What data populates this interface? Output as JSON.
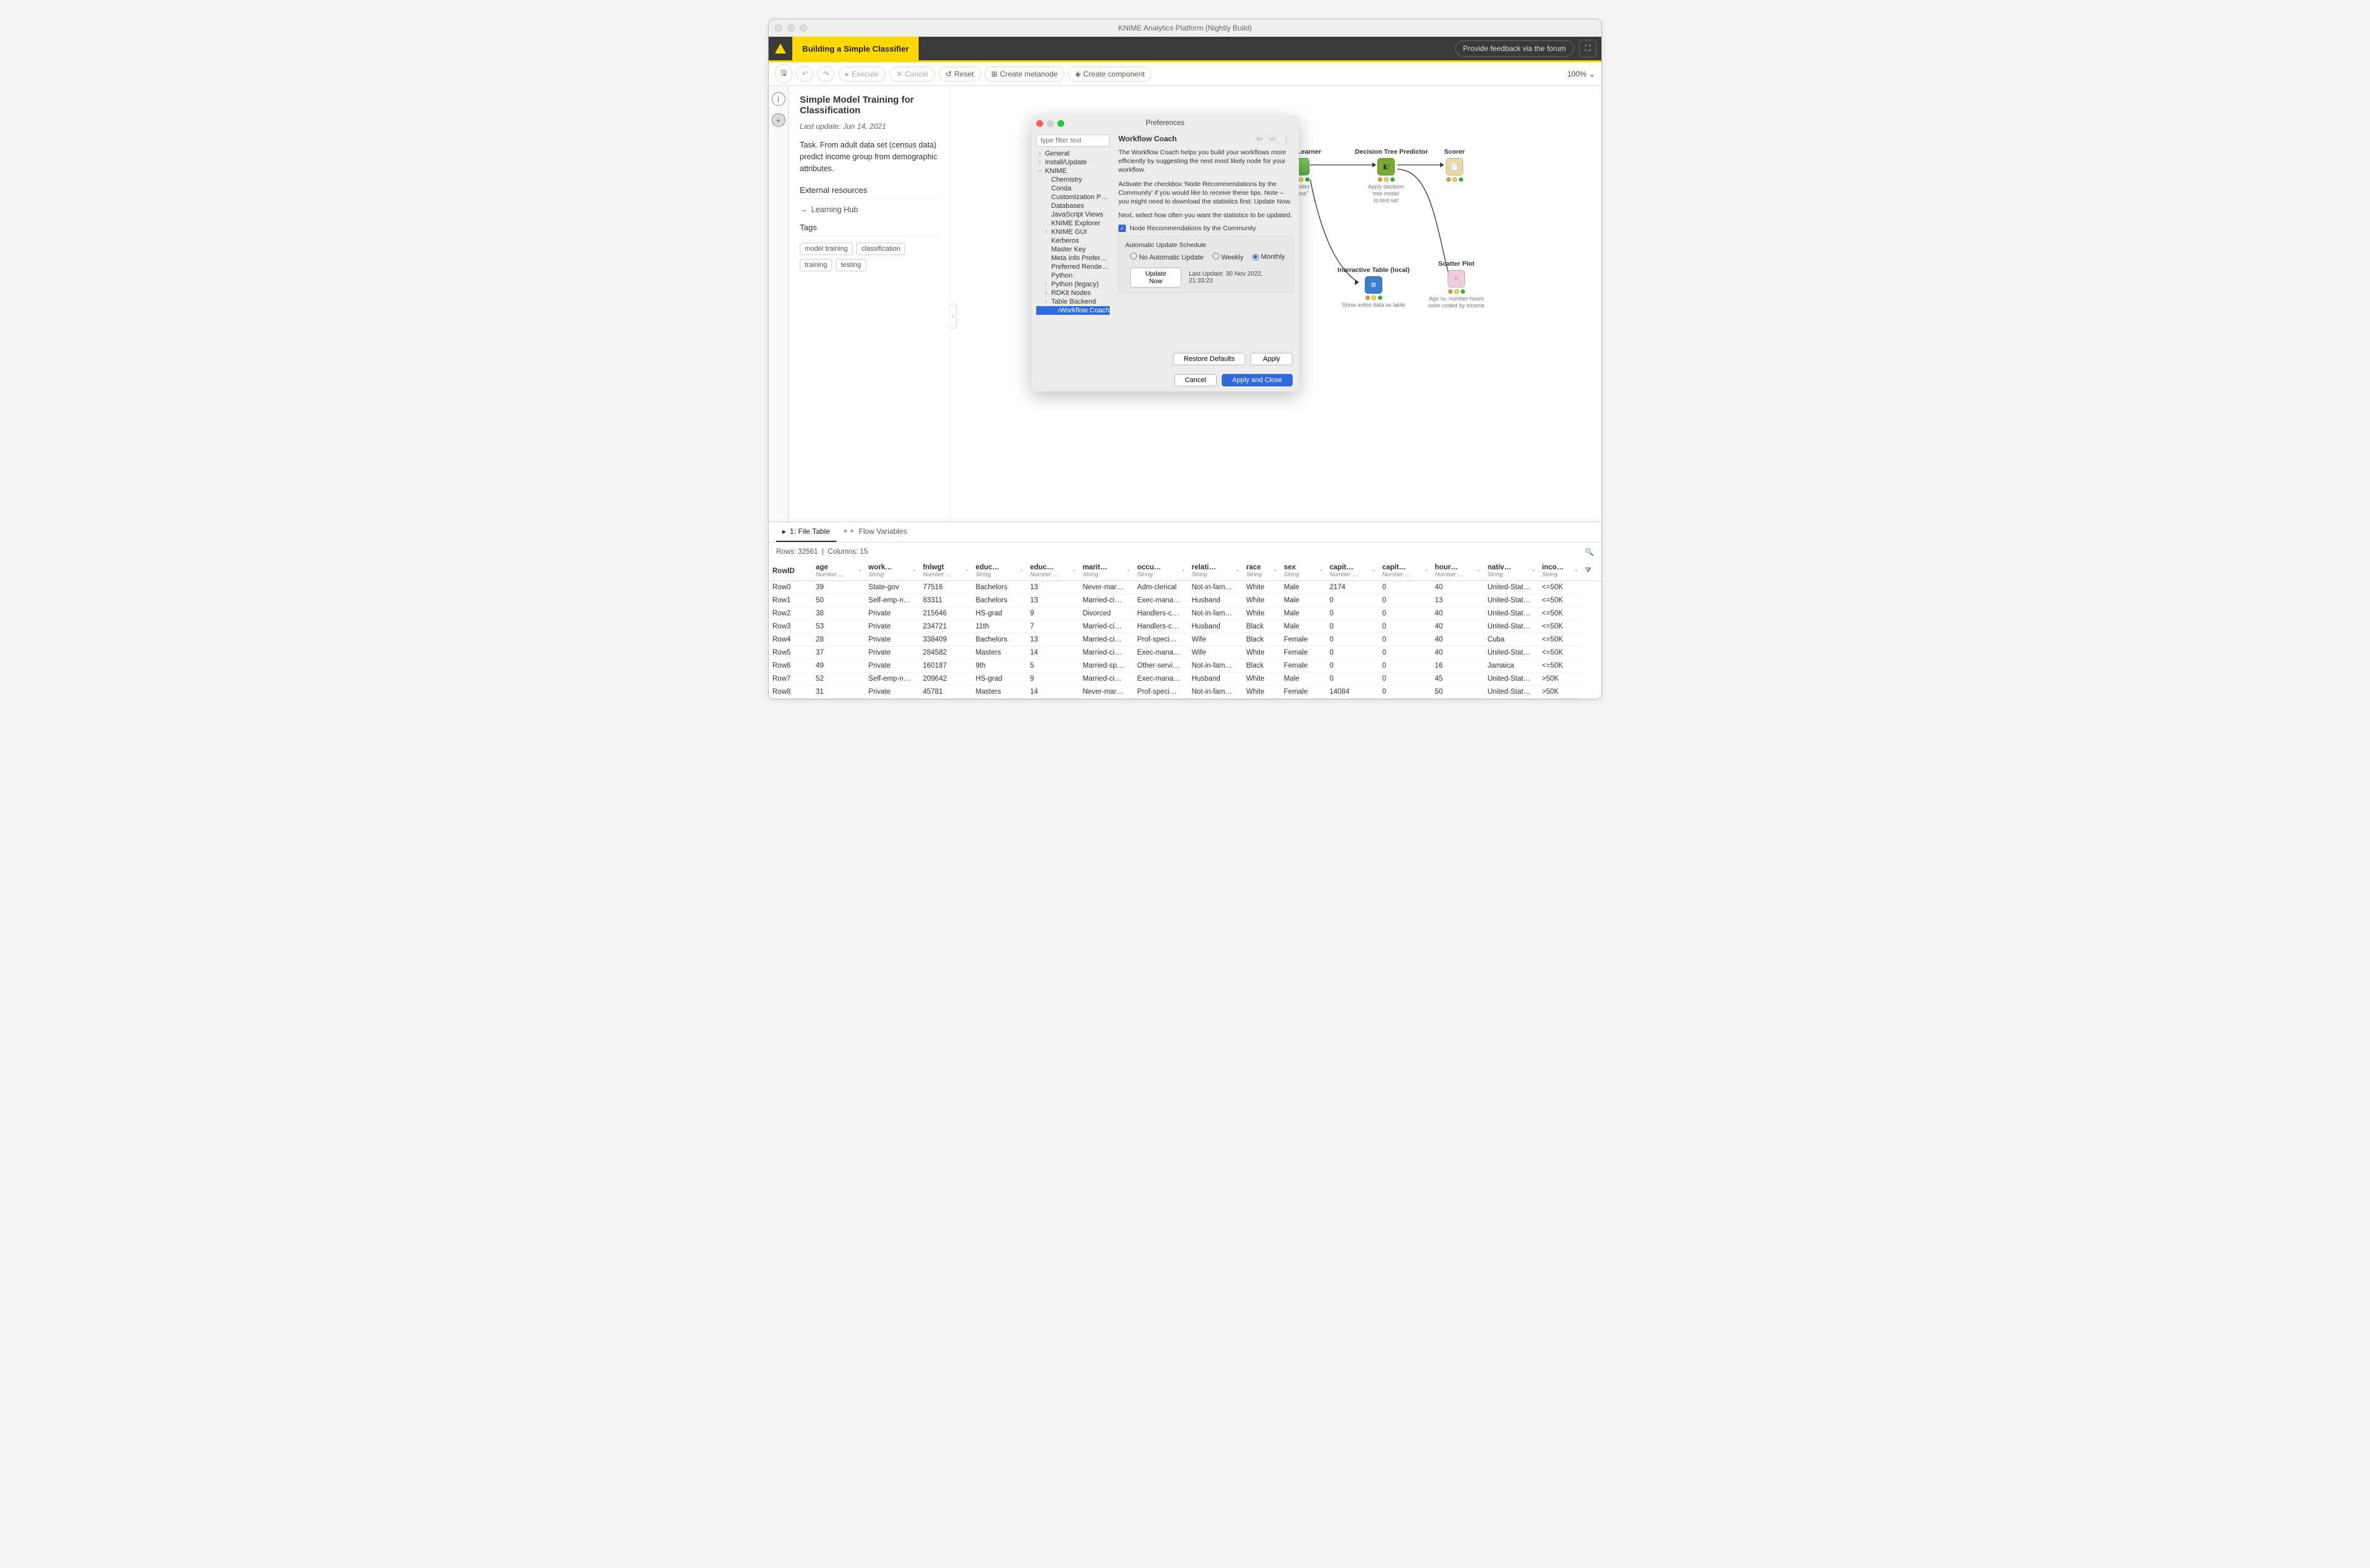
{
  "window_title": "KNIME Analytics Platform (Nightly Build)",
  "workflow_tab": "Building a Simple Classifier",
  "feedback_label": "Provide feedback via the forum",
  "toolbar": {
    "save": "",
    "undo": "",
    "redo": "",
    "execute": "Execute",
    "cancel": "Cancel",
    "reset": "Reset",
    "create_metanode": "Create metanode",
    "create_component": "Create component",
    "zoom": "100%"
  },
  "description": {
    "title": "Simple Model Training for Classification",
    "last_update": "Last update: Jun 14, 2021",
    "task": "Task. From adult data set (census data) predict income group from demographic attributes.",
    "external_heading": "External resources",
    "learning_hub": "Learning Hub",
    "tags_heading": "Tags",
    "tags": [
      "model training",
      "classification",
      "training",
      "testing"
    ]
  },
  "workflow_nodes": {
    "learner": {
      "title": "…e Learner",
      "caption_l1": "…edict",
      "caption_l2": "…me\""
    },
    "predictor": {
      "title": "Decision Tree Predictor",
      "caption_l1": "Apply decision",
      "caption_l2": "tree model",
      "caption_l3": "to test set"
    },
    "scorer": {
      "title": "Scorer"
    },
    "interactive": {
      "title": "Interactive Table (local)",
      "caption_l1": "Show entire data as table"
    },
    "scatter": {
      "title": "Scatter Plot",
      "caption_l1": "Age vs. number-hours",
      "caption_l2": "color-coded by income"
    }
  },
  "preferences": {
    "title": "Preferences",
    "filter_placeholder": "type filter text",
    "tree": {
      "general": "General",
      "install": "Install/Update",
      "knime": "KNIME",
      "chemistry": "Chemistry",
      "conda": "Conda",
      "custom": "Customization Profiles",
      "databases": "Databases",
      "jsviews": "JavaScript Views",
      "explorer": "KNIME Explorer",
      "gui": "KNIME GUI",
      "kerberos": "Kerberos",
      "masterkey": "Master Key",
      "metainfo": "Meta Info Preferences",
      "renderers": "Preferred Renderers",
      "python": "Python",
      "pythonlegacy": "Python (legacy)",
      "rdkit": "RDKit Nodes",
      "tablebackend": "Table Backend",
      "workflowcoach": "Workflow Coach"
    },
    "heading": "Workflow Coach",
    "para1": "The Workflow Coach helps you build your workflows more efficiently by suggesting the next most likely node for your workflow.",
    "para2": "Activate the checkbox 'Node Recommendations by the Community' if you would like to receive these tips. Note – you might need to download the statistics first: Update Now.",
    "para3": "Next, select how often you want the statistics to be updated.",
    "checkbox_label": "Node Recommendations by the Community",
    "schedule_title": "Automatic Update Schedule",
    "radio_none": "No Automatic Update",
    "radio_weekly": "Weekly",
    "radio_monthly": "Monthly",
    "update_now": "Update Now",
    "last_update": "Last Update: 30 Nov 2022, 21:33:22",
    "restore": "Restore Defaults",
    "apply": "Apply",
    "cancel": "Cancel",
    "apply_close": "Apply and Close"
  },
  "bottom": {
    "tab1": "1: File Table",
    "tab2": "Flow Variables",
    "rows_label": "Rows: 32561",
    "cols_label": "Columns: 15"
  },
  "table": {
    "columns": [
      {
        "name": "RowID",
        "type": ""
      },
      {
        "name": "age",
        "type": "Number …"
      },
      {
        "name": "work…",
        "type": "String"
      },
      {
        "name": "fnlwgt",
        "type": "Number …"
      },
      {
        "name": "educ…",
        "type": "String"
      },
      {
        "name": "educ…",
        "type": "Number …"
      },
      {
        "name": "marit…",
        "type": "String"
      },
      {
        "name": "occu…",
        "type": "String"
      },
      {
        "name": "relati…",
        "type": "String"
      },
      {
        "name": "race",
        "type": "String"
      },
      {
        "name": "sex",
        "type": "String"
      },
      {
        "name": "capit…",
        "type": "Number …"
      },
      {
        "name": "capit…",
        "type": "Number …"
      },
      {
        "name": "hour…",
        "type": "Number …"
      },
      {
        "name": "nativ…",
        "type": "String"
      },
      {
        "name": "inco…",
        "type": "String"
      }
    ],
    "rows": [
      [
        "Row0",
        "39",
        "State-gov",
        "77516",
        "Bachelors",
        "13",
        "Never-mar…",
        "Adm-clerical",
        "Not-in-fam…",
        "White",
        "Male",
        "2174",
        "0",
        "40",
        "United-Stat…",
        "<=50K"
      ],
      [
        "Row1",
        "50",
        "Self-emp-n…",
        "83311",
        "Bachelors",
        "13",
        "Married-ci…",
        "Exec-mana…",
        "Husband",
        "White",
        "Male",
        "0",
        "0",
        "13",
        "United-Stat…",
        "<=50K"
      ],
      [
        "Row2",
        "38",
        "Private",
        "215646",
        "HS-grad",
        "9",
        "Divorced",
        "Handlers-c…",
        "Not-in-fam…",
        "White",
        "Male",
        "0",
        "0",
        "40",
        "United-Stat…",
        "<=50K"
      ],
      [
        "Row3",
        "53",
        "Private",
        "234721",
        "11th",
        "7",
        "Married-ci…",
        "Handlers-c…",
        "Husband",
        "Black",
        "Male",
        "0",
        "0",
        "40",
        "United-Stat…",
        "<=50K"
      ],
      [
        "Row4",
        "28",
        "Private",
        "338409",
        "Bachelors",
        "13",
        "Married-ci…",
        "Prof-speci…",
        "Wife",
        "Black",
        "Female",
        "0",
        "0",
        "40",
        "Cuba",
        "<=50K"
      ],
      [
        "Row5",
        "37",
        "Private",
        "284582",
        "Masters",
        "14",
        "Married-ci…",
        "Exec-mana…",
        "Wife",
        "White",
        "Female",
        "0",
        "0",
        "40",
        "United-Stat…",
        "<=50K"
      ],
      [
        "Row6",
        "49",
        "Private",
        "160187",
        "9th",
        "5",
        "Married-sp…",
        "Other-servi…",
        "Not-in-fam…",
        "Black",
        "Female",
        "0",
        "0",
        "16",
        "Jamaica",
        "<=50K"
      ],
      [
        "Row7",
        "52",
        "Self-emp-n…",
        "209642",
        "HS-grad",
        "9",
        "Married-ci…",
        "Exec-mana…",
        "Husband",
        "White",
        "Male",
        "0",
        "0",
        "45",
        "United-Stat…",
        ">50K"
      ],
      [
        "Row8",
        "31",
        "Private",
        "45781",
        "Masters",
        "14",
        "Never-mar…",
        "Prof-speci…",
        "Not-in-fam…",
        "White",
        "Female",
        "14084",
        "0",
        "50",
        "United-Stat…",
        ">50K"
      ]
    ]
  }
}
